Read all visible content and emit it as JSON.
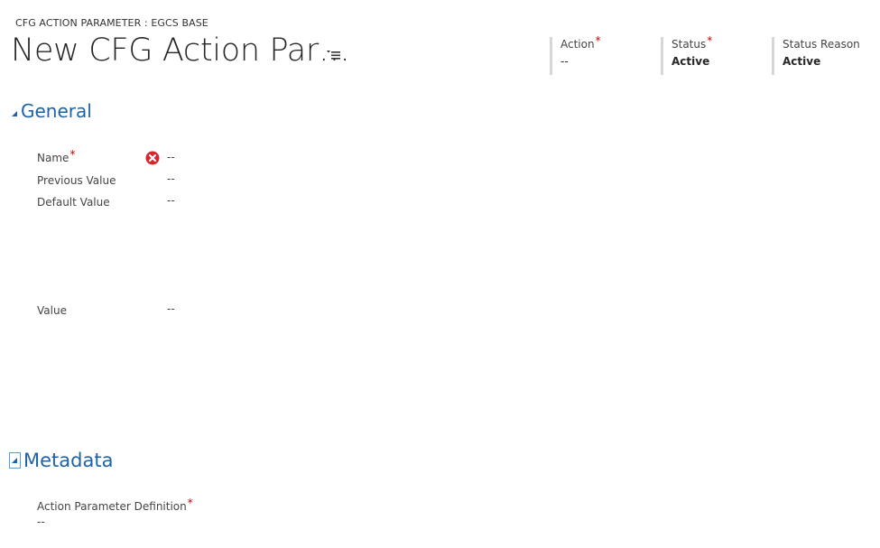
{
  "header": {
    "entity_label": "CFG ACTION PARAMETER : EGCS BASE",
    "record_title": "New CFG Action Par…",
    "fields": [
      {
        "label": "Action",
        "required": "*",
        "value": "--"
      },
      {
        "label": "Status",
        "required": "*",
        "value": "Active"
      },
      {
        "label": "Status Reason",
        "required": "",
        "value": "Active"
      }
    ]
  },
  "general": {
    "title": "General",
    "fields": [
      {
        "label": "Name",
        "required": "*",
        "value": "--"
      },
      {
        "label": "Previous Value",
        "value": "--"
      },
      {
        "label": "Default Value",
        "value": "--"
      },
      {
        "label": "Value",
        "value": "--"
      }
    ]
  },
  "metadata": {
    "title": "Metadata",
    "fields": [
      {
        "label": "Action Parameter Definition",
        "required": "*",
        "value": "--"
      }
    ]
  },
  "icons": {
    "menu": "title-menu-icon",
    "error": "error-icon",
    "expand": "triangle-expanded-icon"
  },
  "colors": {
    "accent": "#1f63a6",
    "required": "#cc0000",
    "error": "#d9262c",
    "divider": "#d6d6d6"
  }
}
